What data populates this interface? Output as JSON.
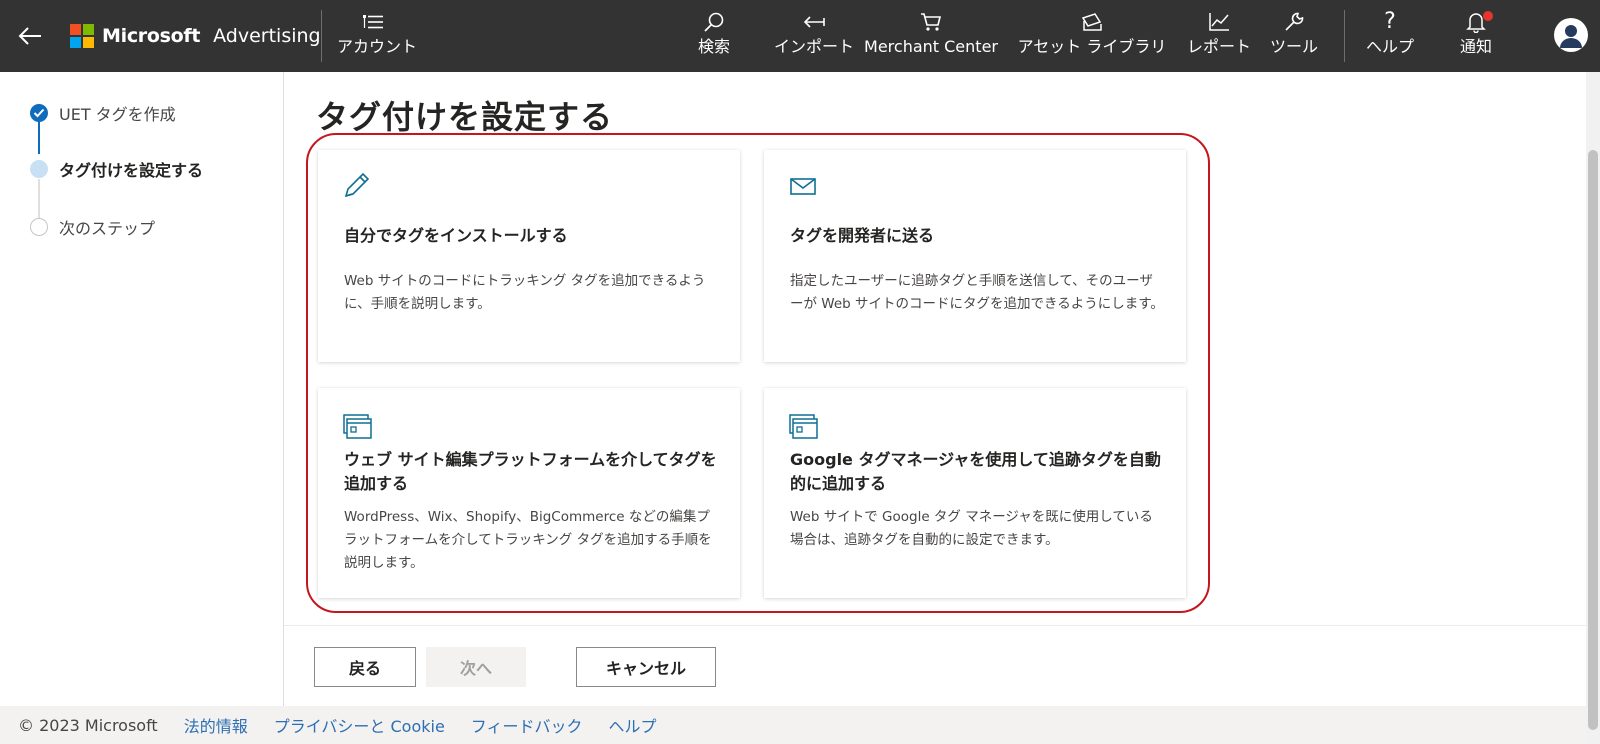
{
  "brand": {
    "name": "Microsoft",
    "product": "Advertising",
    "logo_colors": [
      "#f25022",
      "#7fba00",
      "#00a4ef",
      "#ffb900"
    ]
  },
  "header": {
    "account_label": "アカウント",
    "nav": {
      "search": "検索",
      "import": "インポート",
      "merchant": "Merchant Center",
      "assets": "アセット ライブラリ",
      "reports": "レポート",
      "tools": "ツール",
      "help": "ヘルプ",
      "notifications": "通知"
    }
  },
  "steps": [
    {
      "label": "UET タグを作成",
      "state": "completed"
    },
    {
      "label": "タグ付けを設定する",
      "state": "current"
    },
    {
      "label": "次のステップ",
      "state": "upcoming"
    }
  ],
  "main": {
    "title": "タグ付けを設定する",
    "cards": [
      {
        "icon": "pencil-icon",
        "title": "自分でタグをインストールする",
        "desc": "Web サイトのコードにトラッキング タグを追加できるように、手順を説明します。"
      },
      {
        "icon": "mail-icon",
        "title": "タグを開発者に送る",
        "desc": "指定したユーザーに追跡タグと手順を送信して、そのユーザーが Web サイトのコードにタグを追加できるようにします。"
      },
      {
        "icon": "browser-window-icon",
        "title": "ウェブ サイト編集プラットフォームを介してタグを追加する",
        "desc": "WordPress、Wix、Shopify、BigCommerce などの編集プラットフォームを介してトラッキング タグを追加する手順を説明します。"
      },
      {
        "icon": "browser-window-icon",
        "title": "Google タグマネージャを使用して追跡タグを自動的に追加する",
        "desc": "Web サイトで Google タグ マネージャを既に使用している場合は、追跡タグを自動的に設定できます。"
      }
    ],
    "buttons": {
      "back": "戻る",
      "next": "次へ",
      "cancel": "キャンセル"
    }
  },
  "footer": {
    "copyright": "© 2023 Microsoft",
    "links": [
      "法的情報",
      "プライバシーと Cookie",
      "フィードバック",
      "ヘルプ"
    ]
  },
  "colors": {
    "topbar": "#333333",
    "accent_blue": "#0f6cbd",
    "step_current": "#c7e0f4",
    "highlight_ring": "#c4161c",
    "icon_teal": "#0e6f93",
    "link": "#2c6fb2",
    "notification_badge": "#e3372b"
  }
}
